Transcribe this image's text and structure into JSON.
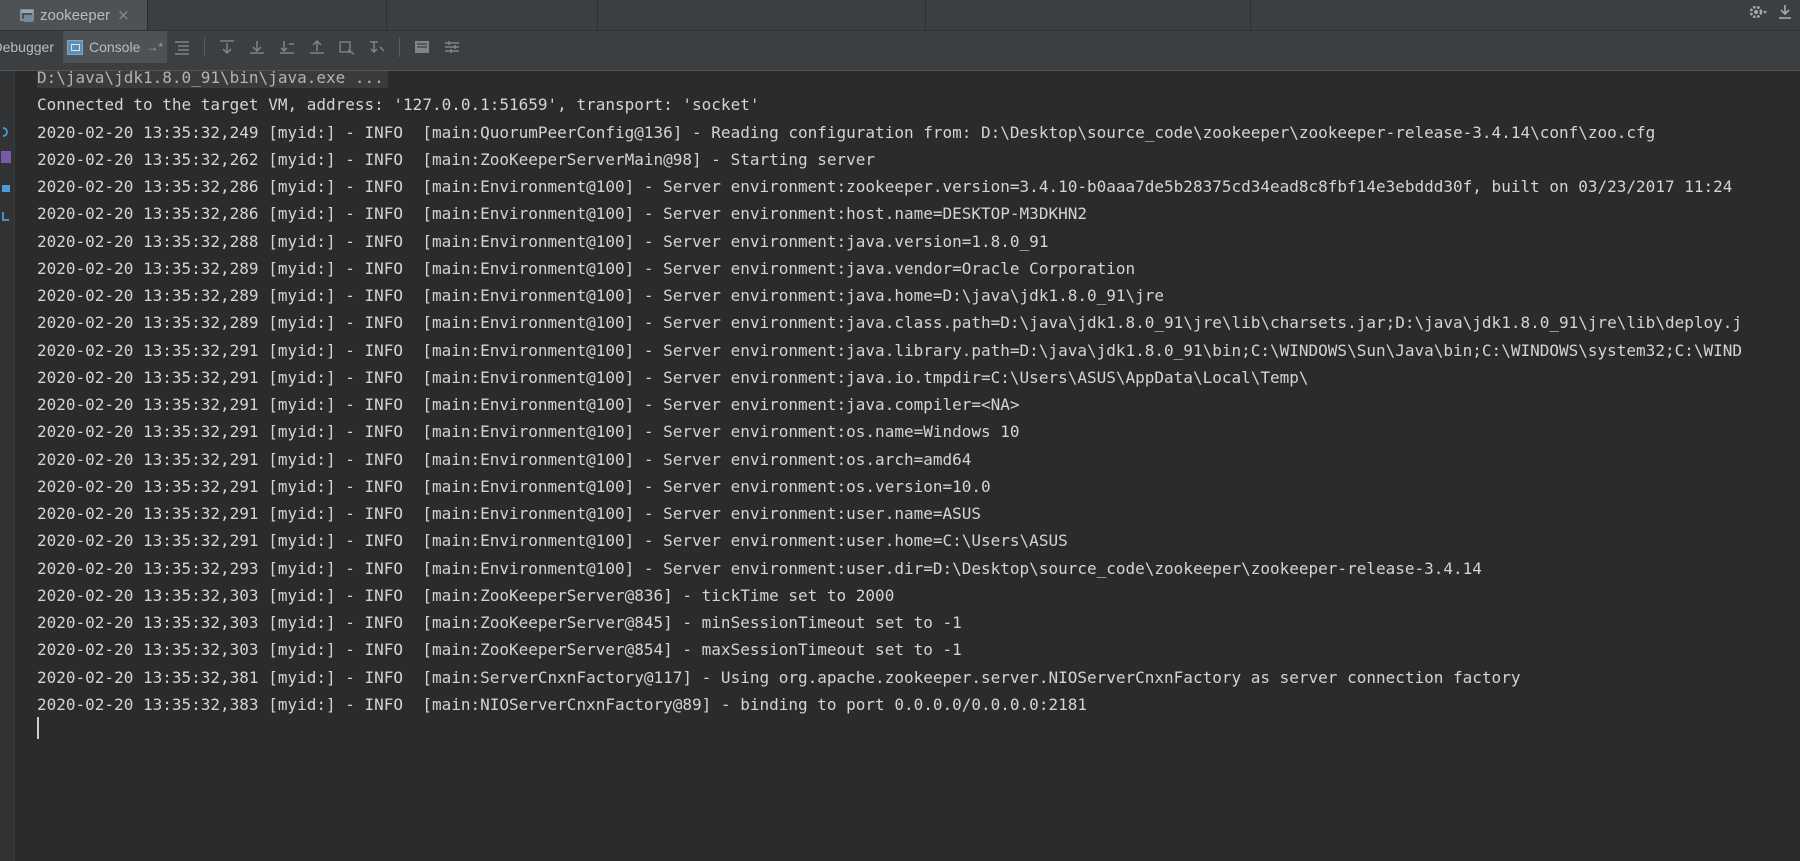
{
  "window": {
    "tab_title": "zookeeper",
    "tab_close": "×",
    "top_right_icons": [
      "gear-icon",
      "download-icon"
    ]
  },
  "toolbar": {
    "debugger_label": "Debugger",
    "console_label": "Console",
    "pin_glyph": "→*",
    "buttons": [
      "show-execution-point-icon",
      "step-over-icon",
      "step-into-icon",
      "force-step-into-icon",
      "step-out-icon",
      "drop-frame-icon",
      "run-to-cursor-icon",
      "evaluate-expression-icon",
      "trace-settings-icon"
    ]
  },
  "console": {
    "lines": [
      "D:\\java\\jdk1.8.0_91\\bin\\java.exe ...",
      "Connected to the target VM, address: '127.0.0.1:51659', transport: 'socket'",
      "2020-02-20 13:35:32,249 [myid:] - INFO  [main:QuorumPeerConfig@136] - Reading configuration from: D:\\Desktop\\source_code\\zookeeper\\zookeeper-release-3.4.14\\conf\\zoo.cfg",
      "2020-02-20 13:35:32,262 [myid:] - INFO  [main:ZooKeeperServerMain@98] - Starting server",
      "2020-02-20 13:35:32,286 [myid:] - INFO  [main:Environment@100] - Server environment:zookeeper.version=3.4.10-b0aaa7de5b28375cd34ead8c8fbf14e3ebddd30f, built on 03/23/2017 11:24",
      "2020-02-20 13:35:32,286 [myid:] - INFO  [main:Environment@100] - Server environment:host.name=DESKTOP-M3DKHN2",
      "2020-02-20 13:35:32,288 [myid:] - INFO  [main:Environment@100] - Server environment:java.version=1.8.0_91",
      "2020-02-20 13:35:32,289 [myid:] - INFO  [main:Environment@100] - Server environment:java.vendor=Oracle Corporation",
      "2020-02-20 13:35:32,289 [myid:] - INFO  [main:Environment@100] - Server environment:java.home=D:\\java\\jdk1.8.0_91\\jre",
      "2020-02-20 13:35:32,289 [myid:] - INFO  [main:Environment@100] - Server environment:java.class.path=D:\\java\\jdk1.8.0_91\\jre\\lib\\charsets.jar;D:\\java\\jdk1.8.0_91\\jre\\lib\\deploy.j",
      "2020-02-20 13:35:32,291 [myid:] - INFO  [main:Environment@100] - Server environment:java.library.path=D:\\java\\jdk1.8.0_91\\bin;C:\\WINDOWS\\Sun\\Java\\bin;C:\\WINDOWS\\system32;C:\\WIND",
      "2020-02-20 13:35:32,291 [myid:] - INFO  [main:Environment@100] - Server environment:java.io.tmpdir=C:\\Users\\ASUS\\AppData\\Local\\Temp\\",
      "2020-02-20 13:35:32,291 [myid:] - INFO  [main:Environment@100] - Server environment:java.compiler=<NA>",
      "2020-02-20 13:35:32,291 [myid:] - INFO  [main:Environment@100] - Server environment:os.name=Windows 10",
      "2020-02-20 13:35:32,291 [myid:] - INFO  [main:Environment@100] - Server environment:os.arch=amd64",
      "2020-02-20 13:35:32,291 [myid:] - INFO  [main:Environment@100] - Server environment:os.version=10.0",
      "2020-02-20 13:35:32,291 [myid:] - INFO  [main:Environment@100] - Server environment:user.name=ASUS",
      "2020-02-20 13:35:32,291 [myid:] - INFO  [main:Environment@100] - Server environment:user.home=C:\\Users\\ASUS",
      "2020-02-20 13:35:32,293 [myid:] - INFO  [main:Environment@100] - Server environment:user.dir=D:\\Desktop\\source_code\\zookeeper\\zookeeper-release-3.4.14",
      "2020-02-20 13:35:32,303 [myid:] - INFO  [main:ZooKeeperServer@836] - tickTime set to 2000",
      "2020-02-20 13:35:32,303 [myid:] - INFO  [main:ZooKeeperServer@845] - minSessionTimeout set to -1",
      "2020-02-20 13:35:32,303 [myid:] - INFO  [main:ZooKeeperServer@854] - maxSessionTimeout set to -1",
      "2020-02-20 13:35:32,381 [myid:] - INFO  [main:ServerCnxnFactory@117] - Using org.apache.zookeeper.server.NIOServerCnxnFactory as server connection factory",
      "2020-02-20 13:35:32,383 [myid:] - INFO  [main:NIOServerCnxnFactory@89] - binding to port 0.0.0.0/0.0.0.0:2181"
    ]
  }
}
